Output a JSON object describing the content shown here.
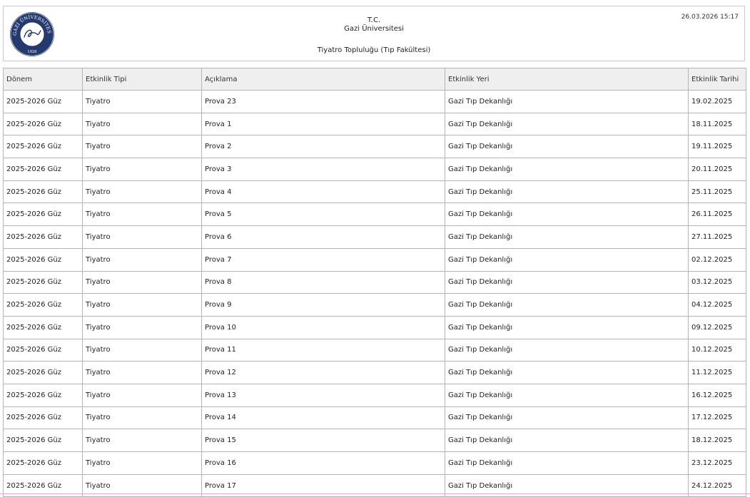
{
  "header": {
    "org_line1": "T.C.",
    "org_line2": "Gazi Üniversitesi",
    "unit": "Tiyatro Topluluğu (Tıp Fakültesi)",
    "printed_at": "26.03.2026 15:17",
    "logo": {
      "arc_text": "GAZİ ÜNİVERSİTESİ",
      "year": "1926",
      "signature": "Gazi",
      "color": "#24396d"
    }
  },
  "table": {
    "columns": [
      "Dönem",
      "Etkinlik Tipi",
      "Açıklama",
      "Etkinlik Yeri",
      "Etkinlik Tarihi"
    ],
    "rows": [
      [
        "2025-2026 Güz",
        "Tiyatro",
        "Prova 23",
        "Gazi Tıp Dekanlığı",
        "19.02.2025"
      ],
      [
        "2025-2026 Güz",
        "Tiyatro",
        "Prova 1",
        "Gazi Tıp Dekanlığı",
        "18.11.2025"
      ],
      [
        "2025-2026 Güz",
        "Tiyatro",
        "Prova 2",
        "Gazi Tıp Dekanlığı",
        "19.11.2025"
      ],
      [
        "2025-2026 Güz",
        "Tiyatro",
        "Prova 3",
        "Gazi Tıp Dekanlığı",
        "20.11.2025"
      ],
      [
        "2025-2026 Güz",
        "Tiyatro",
        "Prova 4",
        "Gazi Tıp Dekanlığı",
        "25.11.2025"
      ],
      [
        "2025-2026 Güz",
        "Tiyatro",
        "Prova 5",
        "Gazi Tıp Dekanlığı",
        "26.11.2025"
      ],
      [
        "2025-2026 Güz",
        "Tiyatro",
        "Prova 6",
        "Gazi Tıp Dekanlığı",
        "27.11.2025"
      ],
      [
        "2025-2026 Güz",
        "Tiyatro",
        "Prova 7",
        "Gazi Tıp Dekanlığı",
        "02.12.2025"
      ],
      [
        "2025-2026 Güz",
        "Tiyatro",
        "Prova 8",
        "Gazi Tıp Dekanlığı",
        "03.12.2025"
      ],
      [
        "2025-2026 Güz",
        "Tiyatro",
        "Prova 9",
        "Gazi Tıp Dekanlığı",
        "04.12.2025"
      ],
      [
        "2025-2026 Güz",
        "Tiyatro",
        "Prova 10",
        "Gazi Tıp Dekanlığı",
        "09.12.2025"
      ],
      [
        "2025-2026 Güz",
        "Tiyatro",
        "Prova 11",
        "Gazi Tıp Dekanlığı",
        "10.12.2025"
      ],
      [
        "2025-2026 Güz",
        "Tiyatro",
        "Prova 12",
        "Gazi Tıp Dekanlığı",
        "11.12.2025"
      ],
      [
        "2025-2026 Güz",
        "Tiyatro",
        "Prova 13",
        "Gazi Tıp Dekanlığı",
        "16.12.2025"
      ],
      [
        "2025-2026 Güz",
        "Tiyatro",
        "Prova 14",
        "Gazi Tıp Dekanlığı",
        "17.12.2025"
      ],
      [
        "2025-2026 Güz",
        "Tiyatro",
        "Prova 15",
        "Gazi Tıp Dekanlığı",
        "18.12.2025"
      ],
      [
        "2025-2026 Güz",
        "Tiyatro",
        "Prova 16",
        "Gazi Tıp Dekanlığı",
        "23.12.2025"
      ],
      [
        "2025-2026 Güz",
        "Tiyatro",
        "Prova 17",
        "Gazi Tıp Dekanlığı",
        "24.12.2025"
      ]
    ]
  }
}
